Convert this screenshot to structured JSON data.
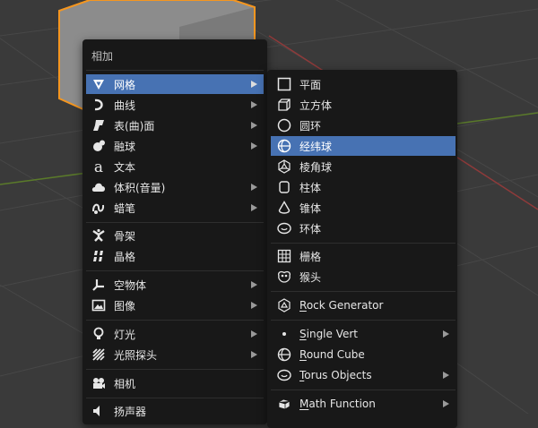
{
  "add_menu": {
    "title": "相加",
    "items": [
      {
        "label": "网格",
        "icon": "mesh-icon",
        "submenu": true,
        "highlighted": true
      },
      {
        "label": "曲线",
        "icon": "curve-icon",
        "submenu": true
      },
      {
        "label": "表(曲)面",
        "icon": "surface-icon",
        "submenu": true
      },
      {
        "label": "融球",
        "icon": "metaball-icon",
        "submenu": true
      },
      {
        "label": "文本",
        "icon": "text-icon",
        "submenu": false
      },
      {
        "label": "体积(音量)",
        "icon": "volume-icon",
        "submenu": true
      },
      {
        "label": "蜡笔",
        "icon": "grease-pencil-icon",
        "submenu": true
      },
      {
        "label": "骨架",
        "icon": "armature-icon",
        "submenu": false
      },
      {
        "label": "晶格",
        "icon": "lattice-icon",
        "submenu": false
      },
      {
        "label": "空物体",
        "icon": "empty-icon",
        "submenu": true
      },
      {
        "label": "图像",
        "icon": "image-icon",
        "submenu": true
      },
      {
        "label": "灯光",
        "icon": "light-icon",
        "submenu": true
      },
      {
        "label": "光照探头",
        "icon": "light-probe-icon",
        "submenu": true
      },
      {
        "label": "相机",
        "icon": "camera-icon",
        "submenu": false
      },
      {
        "label": "扬声器",
        "icon": "speaker-icon",
        "submenu": false
      }
    ]
  },
  "mesh_menu": {
    "items": [
      {
        "label": "平面",
        "icon": "plane-icon",
        "submenu": false
      },
      {
        "label": "立方体",
        "icon": "cube-icon",
        "submenu": false
      },
      {
        "label": "圆环",
        "icon": "circle-icon",
        "submenu": false
      },
      {
        "label": "经纬球",
        "icon": "uv-sphere-icon",
        "submenu": false,
        "highlighted": true
      },
      {
        "label": "棱角球",
        "icon": "ico-sphere-icon",
        "submenu": false
      },
      {
        "label": "柱体",
        "icon": "cylinder-icon",
        "submenu": false
      },
      {
        "label": "锥体",
        "icon": "cone-icon",
        "submenu": false
      },
      {
        "label": "环体",
        "icon": "torus-icon",
        "submenu": false
      },
      {
        "label": "栅格",
        "icon": "grid-icon",
        "submenu": false
      },
      {
        "label": "猴头",
        "icon": "monkey-icon",
        "submenu": false
      },
      {
        "label": "Rock Generator",
        "icon": "rock-icon",
        "submenu": false
      },
      {
        "label": "Single Vert",
        "icon": "vertex-icon",
        "submenu": true
      },
      {
        "label": "Round Cube",
        "icon": "round-cube-icon",
        "submenu": false
      },
      {
        "label": "Torus Objects",
        "icon": "torus-objects-icon",
        "submenu": true
      },
      {
        "label": "Math Function",
        "icon": "math-function-icon",
        "submenu": true
      }
    ]
  },
  "colors": {
    "viewport_bg": "#3a3a3a",
    "grid_line": "#474747",
    "axis_red": "#8f3a3a",
    "axis_green": "#5a7a2a",
    "menu_bg": "#181818",
    "highlight": "#4772b3",
    "selection_outline": "#f5961f",
    "cube_front": "#9a9a9a",
    "cube_right": "#7c7c7c"
  }
}
